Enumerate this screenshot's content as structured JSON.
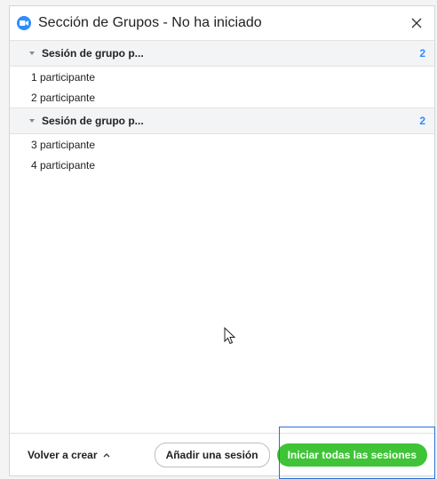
{
  "window": {
    "title": "Sección de Grupos - No ha iniciado"
  },
  "groups": [
    {
      "name": "Sesión de grupo p...",
      "count": "2",
      "participants": [
        "1 participante",
        "2 participante"
      ]
    },
    {
      "name": "Sesión de grupo p...",
      "count": "2",
      "participants": [
        "3 participante",
        "4 participante"
      ]
    }
  ],
  "footer": {
    "recreate_label": "Volver a crear",
    "add_session_label": "Añadir una sesión",
    "start_all_label": "Iniciar todas las sesiones"
  },
  "colors": {
    "accent": "#2d8cff",
    "start_button": "#3ec436",
    "highlight_border": "#2a6fd6"
  }
}
